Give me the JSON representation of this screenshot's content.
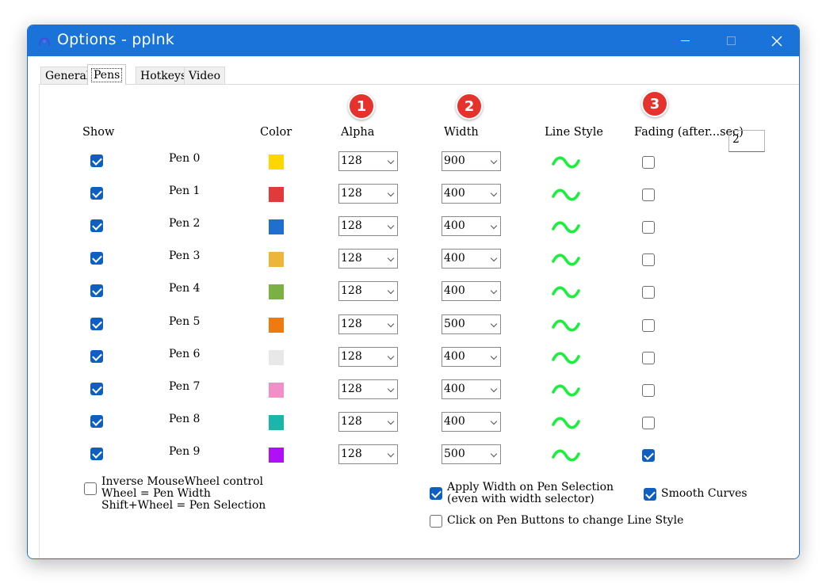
{
  "window": {
    "title": "Options - ppInk"
  },
  "tabs": [
    {
      "label": "General",
      "active": false
    },
    {
      "label": "Pens",
      "active": true
    },
    {
      "label": "Hotkeys",
      "active": false
    },
    {
      "label": "Video",
      "active": false
    }
  ],
  "headers": {
    "show": "Show",
    "color": "Color",
    "alpha": "Alpha",
    "width": "Width",
    "line_style": "Line Style",
    "fading": "Fading (after...sec)"
  },
  "fading_value": "2",
  "badges": [
    "1",
    "2",
    "3"
  ],
  "pens": [
    {
      "label": "Pen 0",
      "show": true,
      "color": "#FFD700",
      "alpha": "128",
      "width": "900",
      "fading": false
    },
    {
      "label": "Pen 1",
      "show": true,
      "color": "#E23A3A",
      "alpha": "128",
      "width": "400",
      "fading": false
    },
    {
      "label": "Pen 2",
      "show": true,
      "color": "#1F6FCF",
      "alpha": "128",
      "width": "400",
      "fading": false
    },
    {
      "label": "Pen 3",
      "show": true,
      "color": "#EDB63A",
      "alpha": "128",
      "width": "400",
      "fading": false
    },
    {
      "label": "Pen 4",
      "show": true,
      "color": "#7BB042",
      "alpha": "128",
      "width": "400",
      "fading": false
    },
    {
      "label": "Pen 5",
      "show": true,
      "color": "#EE7A12",
      "alpha": "128",
      "width": "500",
      "fading": false
    },
    {
      "label": "Pen 6",
      "show": true,
      "color": "#E8E8E8",
      "alpha": "128",
      "width": "400",
      "fading": false
    },
    {
      "label": "Pen 7",
      "show": true,
      "color": "#F28FC8",
      "alpha": "128",
      "width": "400",
      "fading": false
    },
    {
      "label": "Pen 8",
      "show": true,
      "color": "#1BB5A9",
      "alpha": "128",
      "width": "400",
      "fading": false
    },
    {
      "label": "Pen 9",
      "show": true,
      "color": "#B010F5",
      "alpha": "128",
      "width": "500",
      "fading": true
    }
  ],
  "line_style_color": "#19F03C",
  "options": {
    "inverse_wheel": {
      "checked": false,
      "line1": "Inverse MouseWheel control",
      "line2": "Wheel = Pen Width",
      "line3": "Shift+Wheel = Pen Selection"
    },
    "apply_width": {
      "checked": true,
      "line1": "Apply Width on Pen Selection",
      "line2": "(even with width selector)"
    },
    "smooth_curves": {
      "checked": true,
      "label": "Smooth Curves"
    },
    "click_pen_buttons": {
      "checked": false,
      "label": "Click on Pen Buttons to change Line Style"
    }
  },
  "colors": {
    "titlebar": "#1A73D8",
    "checkbox_checked": "#0F5FC0",
    "badge": "#E5322D"
  }
}
